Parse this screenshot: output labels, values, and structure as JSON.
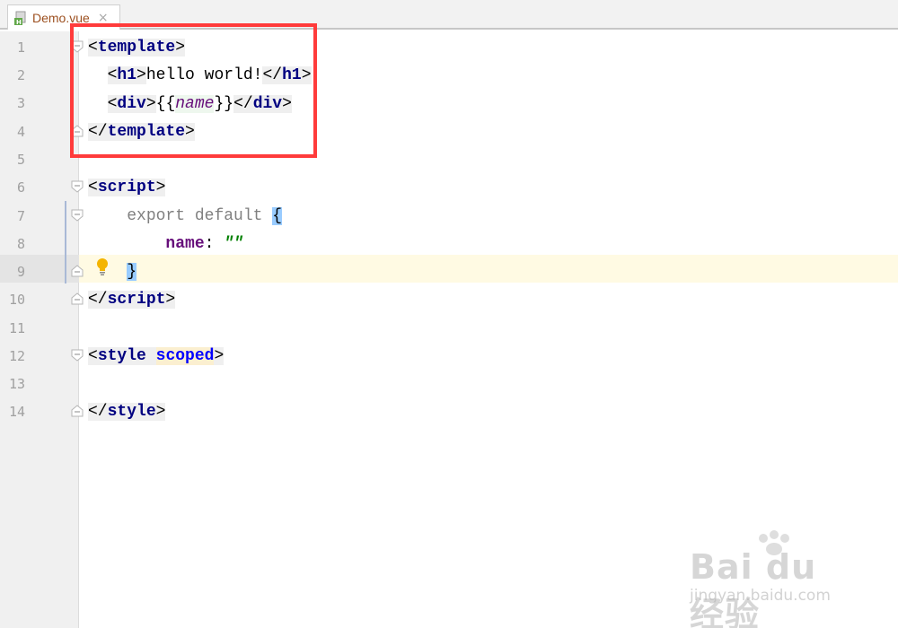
{
  "tab": {
    "title": "Demo.vue",
    "close_glyph": "×",
    "icon": "vue-file-icon"
  },
  "lines": {
    "l1": {
      "num": "1",
      "open": "<",
      "tag": "template",
      "close": ">"
    },
    "l2": {
      "num": "2",
      "open": "<",
      "tag": "h1",
      "close": ">",
      "text": "hello world!",
      "end_open": "</",
      "end_tag": "h1",
      "end_close": ">"
    },
    "l3": {
      "num": "3",
      "open": "<",
      "tag": "div",
      "close": ">",
      "lb": "{{",
      "expr": "name",
      "rb": "}}",
      "end_open": "</",
      "end_tag": "div",
      "end_close": ">"
    },
    "l4": {
      "num": "4",
      "open": "</",
      "tag": "template",
      "close": ">"
    },
    "l5": {
      "num": "5"
    },
    "l6": {
      "num": "6",
      "open": "<",
      "tag": "script",
      "close": ">"
    },
    "l7": {
      "num": "7",
      "export": "export",
      "default": "default",
      "brace": "{"
    },
    "l8": {
      "num": "8",
      "key": "name",
      "colon": ": ",
      "value": "\"\""
    },
    "l9": {
      "num": "9",
      "brace": "}"
    },
    "l10": {
      "num": "10",
      "open": "</",
      "tag": "script",
      "close": ">"
    },
    "l11": {
      "num": "11"
    },
    "l12": {
      "num": "12",
      "open": "<",
      "tag": "style",
      "attr": "scoped",
      "close": ">"
    },
    "l13": {
      "num": "13"
    },
    "l14": {
      "num": "14",
      "open": "</",
      "tag": "style",
      "close": ">"
    }
  },
  "watermark": {
    "main": "Bai du 经验",
    "sub": "jingyan.baidu.com"
  },
  "colors": {
    "highlight_box": "#ff3b3b",
    "current_line": "#fffae3",
    "tag": "#000080",
    "string": "#008000"
  }
}
